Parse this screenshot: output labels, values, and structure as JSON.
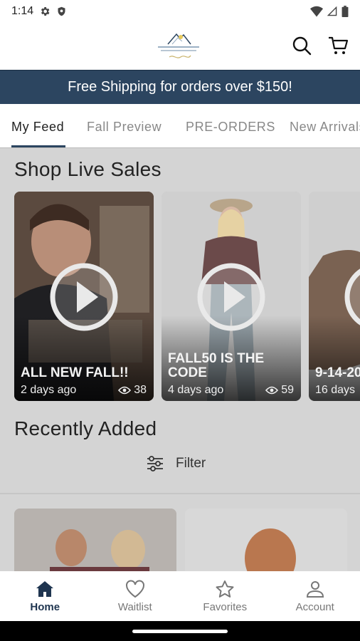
{
  "status_bar": {
    "time": "1:14"
  },
  "header": {
    "logo_alt": "Boutique logo"
  },
  "promo_banner": {
    "text": "Free Shipping for orders over $150!"
  },
  "tabs": [
    {
      "label": "My Feed",
      "active": true
    },
    {
      "label": "Fall Preview",
      "active": false
    },
    {
      "label": "PRE-ORDERS",
      "active": false
    },
    {
      "label": "New Arrivals",
      "active": false
    }
  ],
  "live_sales": {
    "title": "Shop Live Sales",
    "cards": [
      {
        "title": "ALL NEW FALL!!",
        "meta": "2 days ago",
        "views": "38"
      },
      {
        "title": "FALL50 IS THE CODE",
        "meta": "4 days ago",
        "views": "59"
      },
      {
        "title": "9-14-20",
        "meta": "16 days",
        "views": ""
      }
    ]
  },
  "recent": {
    "title": "Recently Added",
    "filter_label": "Filter"
  },
  "bottom_nav": [
    {
      "label": "Home",
      "icon": "home-icon",
      "active": true
    },
    {
      "label": "Waitlist",
      "icon": "heart-icon",
      "active": false
    },
    {
      "label": "Favorites",
      "icon": "star-icon",
      "active": false
    },
    {
      "label": "Account",
      "icon": "person-icon",
      "active": false
    }
  ],
  "colors": {
    "brand_navy": "#2c4560",
    "nav_active": "#1f3550",
    "overlay": "#d4d4d4"
  }
}
